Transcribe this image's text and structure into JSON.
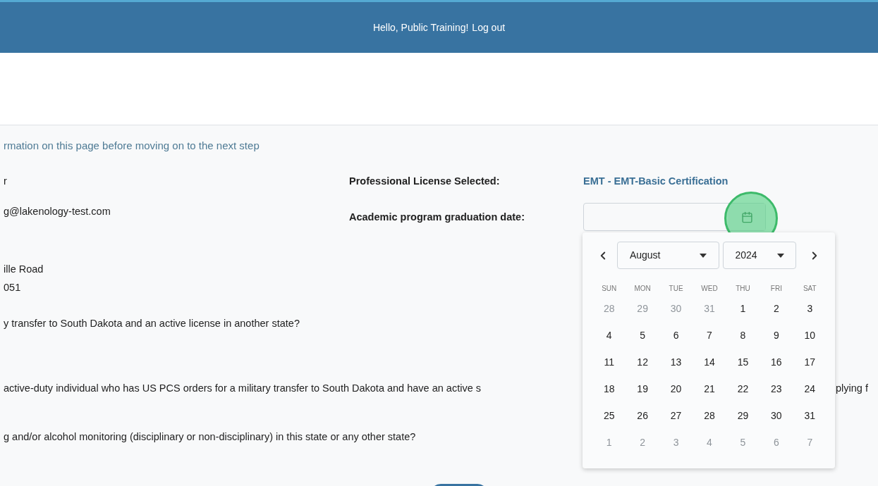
{
  "header": {
    "greeting": "Hello, Public Training!",
    "logout": "Log out"
  },
  "intro": "rmation on this page before moving on to the next step",
  "profile": {
    "name": "r",
    "email": "g@lakenology-test.com",
    "address_lines": [
      "ille Road",
      "051"
    ]
  },
  "details": {
    "license_label": "Professional License Selected:",
    "license_value": "EMT - EMT-Basic Certification",
    "date_label": "Academic program graduation date:",
    "date_highlight": true
  },
  "questions": [
    {
      "text": "y transfer to South Dakota and an active license in another state?"
    },
    {
      "text": "active-duty individual who has US PCS orders for a military transfer to South Dakota and have an active s",
      "text_after": "plying f"
    },
    {
      "text": "g and/or alcohol monitoring (disciplinary or non-disciplinary) in this state or any other state?"
    }
  ],
  "datepicker": {
    "month": "August",
    "year": "2024",
    "weekdays": [
      "SUN",
      "MON",
      "TUE",
      "WED",
      "THU",
      "FRI",
      "SAT"
    ],
    "weeks": [
      [
        {
          "day": "28",
          "outside": true
        },
        {
          "day": "29",
          "outside": true
        },
        {
          "day": "30",
          "outside": true
        },
        {
          "day": "31",
          "outside": true
        },
        {
          "day": "1",
          "outside": false
        },
        {
          "day": "2",
          "outside": false
        },
        {
          "day": "3",
          "outside": false
        }
      ],
      [
        {
          "day": "4",
          "outside": false
        },
        {
          "day": "5",
          "outside": false
        },
        {
          "day": "6",
          "outside": false
        },
        {
          "day": "7",
          "outside": false
        },
        {
          "day": "8",
          "outside": false
        },
        {
          "day": "9",
          "outside": false
        },
        {
          "day": "10",
          "outside": false
        }
      ],
      [
        {
          "day": "11",
          "outside": false
        },
        {
          "day": "12",
          "outside": false
        },
        {
          "day": "13",
          "outside": false
        },
        {
          "day": "14",
          "outside": false
        },
        {
          "day": "15",
          "outside": false
        },
        {
          "day": "16",
          "outside": false
        },
        {
          "day": "17",
          "outside": false
        }
      ],
      [
        {
          "day": "18",
          "outside": false
        },
        {
          "day": "19",
          "outside": false
        },
        {
          "day": "20",
          "outside": false
        },
        {
          "day": "21",
          "outside": false
        },
        {
          "day": "22",
          "outside": false
        },
        {
          "day": "23",
          "outside": false
        },
        {
          "day": "24",
          "outside": false
        }
      ],
      [
        {
          "day": "25",
          "outside": false
        },
        {
          "day": "26",
          "outside": false
        },
        {
          "day": "27",
          "outside": false
        },
        {
          "day": "28",
          "outside": false
        },
        {
          "day": "29",
          "outside": false
        },
        {
          "day": "30",
          "outside": false
        },
        {
          "day": "31",
          "outside": false
        }
      ],
      [
        {
          "day": "1",
          "outside": true
        },
        {
          "day": "2",
          "outside": true
        },
        {
          "day": "3",
          "outside": true
        },
        {
          "day": "4",
          "outside": true
        },
        {
          "day": "5",
          "outside": true
        },
        {
          "day": "6",
          "outside": true
        },
        {
          "day": "7",
          "outside": true
        }
      ]
    ]
  }
}
